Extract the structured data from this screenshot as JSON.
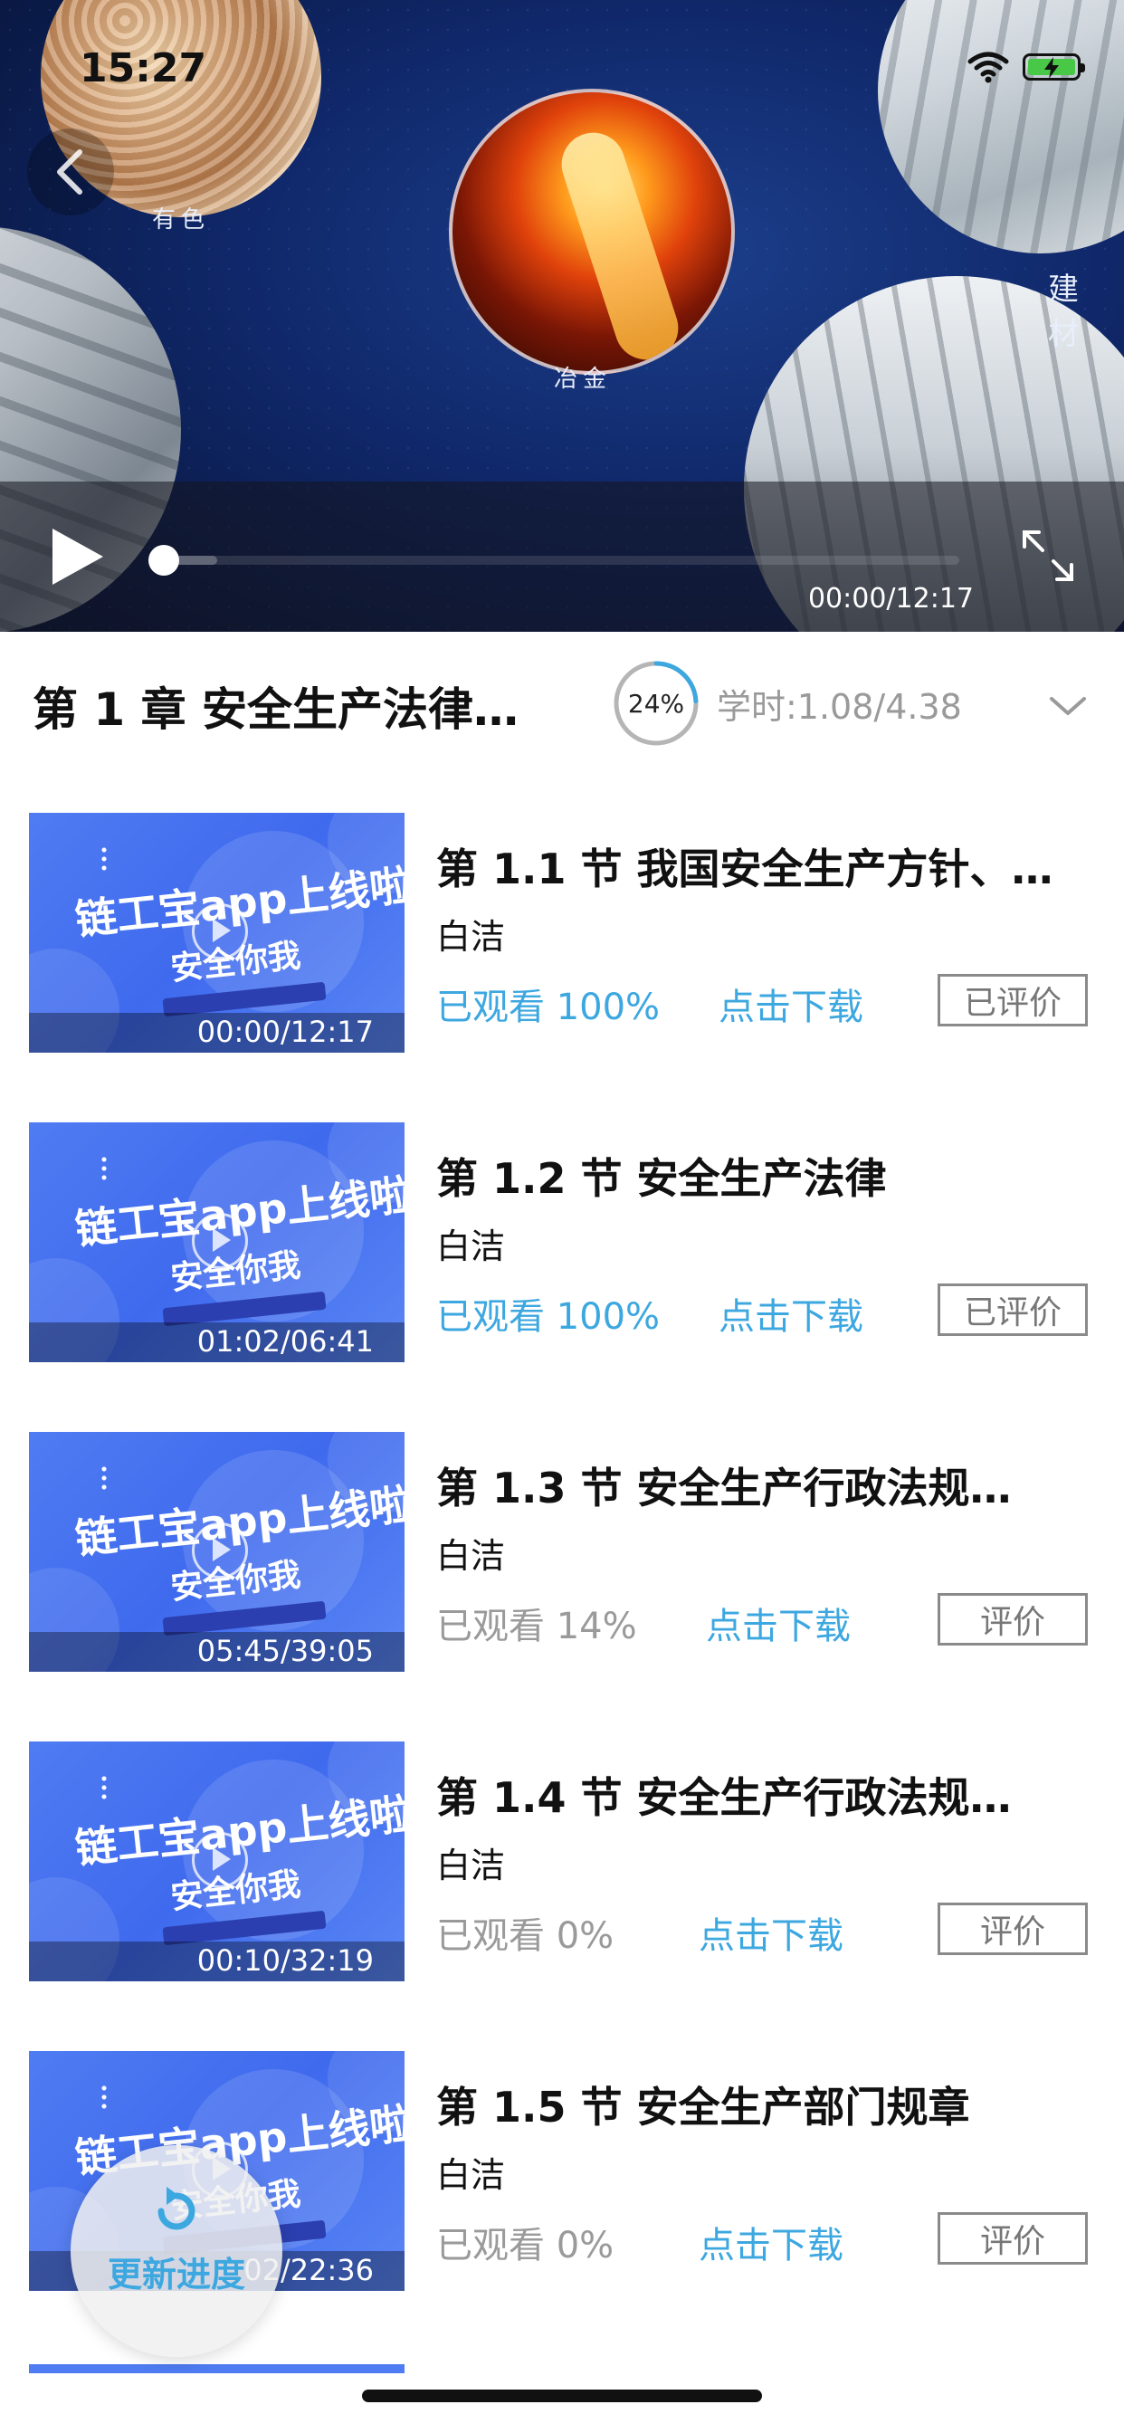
{
  "status_bar": {
    "time": "15:27"
  },
  "player": {
    "labels": {
      "copper": "有色",
      "metallurgy": "冶金",
      "building": "建 材"
    },
    "time_readout": "00:00/12:17",
    "progress": 0.0
  },
  "chapter": {
    "title": "第 1 章  安全生产法律…",
    "progress_percent": 24,
    "progress_text": "24%",
    "hours_text": "学时:1.08/4.38"
  },
  "thumbnail_text": {
    "line1": "链工宝app上线啦!",
    "line2": "安全你我"
  },
  "colors": {
    "accent": "#3da7e0",
    "progress_gray": "#9a9a9a",
    "thumbnail_blue": "#4f7cf2"
  },
  "lessons": [
    {
      "title": "第 1.1 节  我国安全生产方针、…",
      "author": "白洁",
      "duration": "00:00/12:17",
      "progress": "已观看 100%",
      "completed": true,
      "download": "点击下载",
      "rating": "已评价"
    },
    {
      "title": "第 1.2 节  安全生产法律",
      "author": "白洁",
      "duration": "01:02/06:41",
      "progress": "已观看 100%",
      "completed": true,
      "download": "点击下载",
      "rating": "已评价"
    },
    {
      "title": "第 1.3 节  安全生产行政法规…",
      "author": "白洁",
      "duration": "05:45/39:05",
      "progress": "已观看 14%",
      "completed": false,
      "download": "点击下载",
      "rating": "评价"
    },
    {
      "title": "第 1.4 节  安全生产行政法规…",
      "author": "白洁",
      "duration": "00:10/32:19",
      "progress": "已观看 0%",
      "completed": false,
      "download": "点击下载",
      "rating": "评价"
    },
    {
      "title": "第 1.5 节  安全生产部门规章",
      "author": "白洁",
      "duration": "02/22:36",
      "progress": "已观看 0%",
      "completed": false,
      "download": "点击下载",
      "rating": "评价"
    }
  ],
  "fab": {
    "label": "更新进度",
    "icon": "refresh-icon"
  },
  "icons": {
    "back": "chevron-left-icon",
    "play": "play-icon",
    "fullscreen": "fullscreen-icon",
    "expand": "chevron-down-icon",
    "wifi": "wifi-icon",
    "battery": "battery-charging-icon"
  }
}
